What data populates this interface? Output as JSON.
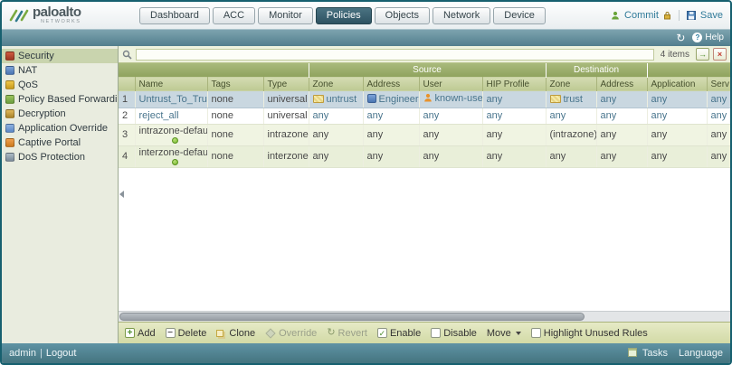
{
  "glyphs": {
    "refresh": "↻",
    "question": "?",
    "plus": "+",
    "minus": "−",
    "check": "✓",
    "cross": "×",
    "arrow_right": "→",
    "pipe": "|"
  },
  "brand": {
    "logo_text": "paloalto",
    "logo_sub": "NETWORKS"
  },
  "nav": {
    "tabs": [
      {
        "label": "Dashboard"
      },
      {
        "label": "ACC"
      },
      {
        "label": "Monitor"
      },
      {
        "label": "Policies"
      },
      {
        "label": "Objects"
      },
      {
        "label": "Network"
      },
      {
        "label": "Device"
      }
    ],
    "commit_label": "Commit",
    "save_label": "Save"
  },
  "subheader": {
    "help_label": "Help"
  },
  "sidebar": {
    "items": [
      {
        "label": "Security"
      },
      {
        "label": "NAT"
      },
      {
        "label": "QoS"
      },
      {
        "label": "Policy Based Forwarding"
      },
      {
        "label": "Decryption"
      },
      {
        "label": "Application Override"
      },
      {
        "label": "Captive Portal"
      },
      {
        "label": "DoS Protection"
      }
    ]
  },
  "filter_bar": {
    "items_count": "4 items"
  },
  "table": {
    "group_source": "Source",
    "group_destination": "Destination",
    "columns": {
      "name": "Name",
      "tags": "Tags",
      "type": "Type",
      "src_zone": "Zone",
      "src_address": "Address",
      "user": "User",
      "hip": "HIP Profile",
      "dst_zone": "Zone",
      "dst_address": "Address",
      "application": "Application",
      "service": "Serv"
    },
    "rows": [
      {
        "num": "1",
        "name": "Untrust_To_Trust",
        "tags": "none",
        "type": "universal",
        "src_zone": "untrust",
        "src_address": "Engineering",
        "user": "known-user",
        "hip": "any",
        "dst_zone": "trust",
        "dst_address": "any",
        "application": "any",
        "service": "any"
      },
      {
        "num": "2",
        "name": "reject_all",
        "tags": "none",
        "type": "universal",
        "src_zone": "any",
        "src_address": "any",
        "user": "any",
        "hip": "any",
        "dst_zone": "any",
        "dst_address": "any",
        "application": "any",
        "service": "any"
      },
      {
        "num": "3",
        "name": "intrazone-default",
        "tags": "none",
        "type": "intrazone",
        "src_zone": "any",
        "src_address": "any",
        "user": "any",
        "hip": "any",
        "dst_zone": "(intrazone)",
        "dst_address": "any",
        "application": "any",
        "service": "any"
      },
      {
        "num": "4",
        "name": "interzone-default",
        "tags": "none",
        "type": "interzone",
        "src_zone": "any",
        "src_address": "any",
        "user": "any",
        "hip": "any",
        "dst_zone": "any",
        "dst_address": "any",
        "application": "any",
        "service": "any"
      }
    ]
  },
  "footer_toolbar": {
    "add": "Add",
    "delete": "Delete",
    "clone": "Clone",
    "override": "Override",
    "revert": "Revert",
    "enable": "Enable",
    "disable": "Disable",
    "move": "Move",
    "highlight": "Highlight Unused Rules"
  },
  "status_bar": {
    "user": "admin",
    "logout": "Logout",
    "tasks": "Tasks",
    "language": "Language"
  }
}
